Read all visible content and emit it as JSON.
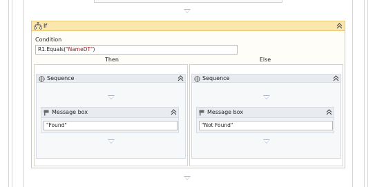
{
  "if_activity": {
    "title": "If",
    "condition_label": "Condition",
    "condition_value_prefix": "R1.Equals(",
    "condition_value_string": "\"NameDT\"",
    "condition_value_suffix": ")"
  },
  "then_branch": {
    "label": "Then",
    "sequence_title": "Sequence",
    "message_box_title": "Message box",
    "message_box_text": "\"Found\""
  },
  "else_branch": {
    "label": "Else",
    "sequence_title": "Sequence",
    "message_box_title": "Message box",
    "message_box_text": "\"Not Found\""
  },
  "icons": {
    "if": "if-activity-icon",
    "sequence": "sequence-icon",
    "message_box": "message-box-icon",
    "collapse": "chevron-double-up-icon",
    "drop": "drop-target-arrow-icon"
  },
  "colors": {
    "if_header": "#fbe7ad",
    "if_border": "#e6c873",
    "sequence_header": "#e8ecf1",
    "string_literal": "#a31515"
  }
}
